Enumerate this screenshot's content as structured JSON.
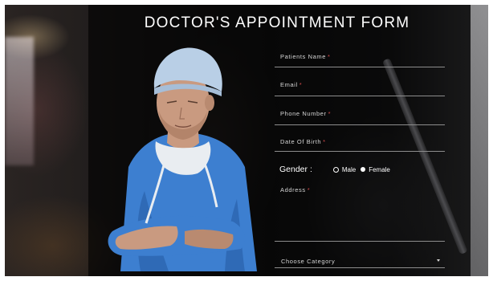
{
  "form": {
    "title": "DOCTOR'S APPOINTMENT FORM",
    "fields": [
      {
        "label": "Patients Name",
        "required": "*"
      },
      {
        "label": "Email",
        "required": "*"
      },
      {
        "label": "Phone Number",
        "required": "*"
      },
      {
        "label": "Date Of Birth",
        "required": "*"
      }
    ],
    "gender": {
      "label": "Gender :",
      "options": [
        {
          "label": "Male",
          "selected": false
        },
        {
          "label": "Female",
          "selected": true
        }
      ]
    },
    "address": {
      "label": "Address",
      "required": "*"
    },
    "category": {
      "placeholder": "Choose Category"
    }
  },
  "colors": {
    "overlay": "#000000",
    "text": "#ffffff",
    "label": "#d6d6d6",
    "required": "#d34a4a",
    "scrub": "#3d7fd0",
    "cap": "#b9cfe6"
  }
}
